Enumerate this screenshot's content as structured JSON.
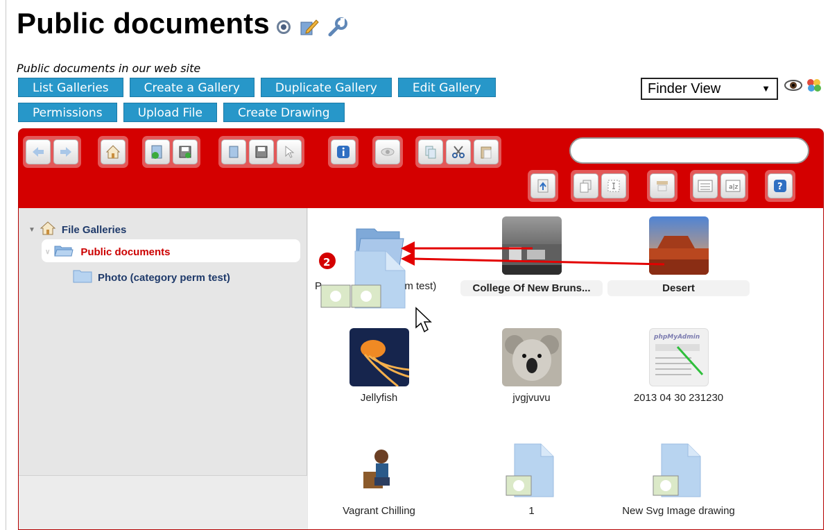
{
  "header": {
    "title": "Public documents",
    "description": "Public documents in our web site"
  },
  "buttons": {
    "row1": [
      "List Galleries",
      "Create a Gallery",
      "Duplicate Gallery",
      "Edit Gallery"
    ],
    "row2": [
      "Permissions",
      "Upload File",
      "Create Drawing"
    ]
  },
  "view_select": {
    "value": "Finder View"
  },
  "tree": {
    "root": "File Galleries",
    "selected": "Public documents",
    "child": "Photo (category perm test)"
  },
  "files": [
    {
      "label": "Photo (category perm test)",
      "visible_label": "P",
      "visible_label_end": "erm test)"
    },
    {
      "label": "College Of New Bruns..."
    },
    {
      "label": "Desert"
    },
    {
      "label": "Jellyfish"
    },
    {
      "label": "jvgjvuvu"
    },
    {
      "label": "2013 04 30 231230"
    },
    {
      "label": "Vagrant Chilling"
    },
    {
      "label": "1"
    },
    {
      "label": "New Svg Image drawing"
    }
  ],
  "drag": {
    "badge_count": "2"
  },
  "thumbs": {
    "phpmyadmin_logo": "phpMyAdmin"
  },
  "colors": {
    "accent": "#d40000",
    "button": "#2797c9",
    "selected_text": "#cc0000"
  }
}
